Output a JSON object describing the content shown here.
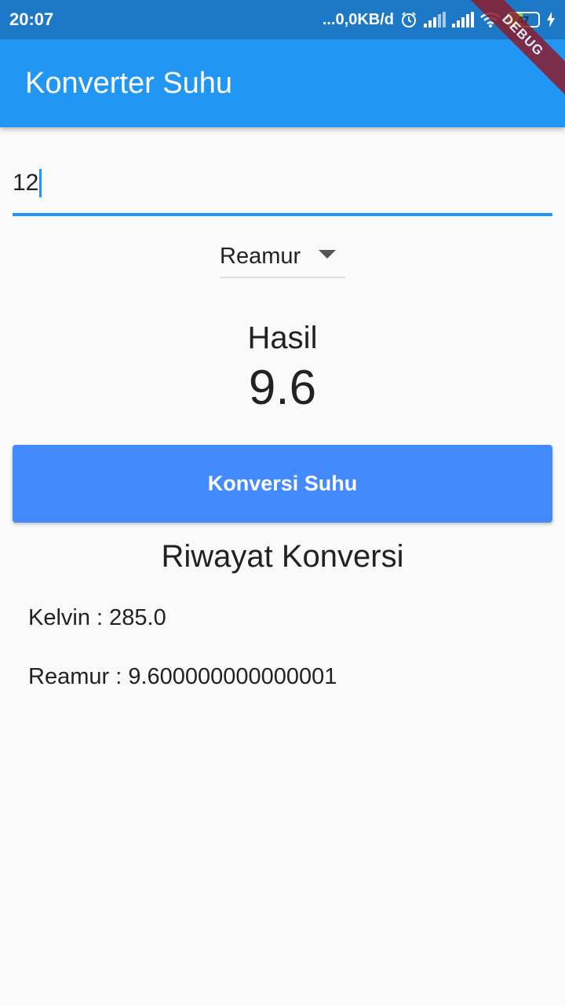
{
  "status_bar": {
    "time": "20:07",
    "network_speed": "...0,0KB/d",
    "battery_level": "47",
    "icons": [
      "alarm-icon",
      "signal-icon",
      "signal-icon",
      "wifi-icon",
      "battery-icon",
      "charging-icon"
    ]
  },
  "app_bar": {
    "title": "Konverter Suhu"
  },
  "debug_banner": "DEBUG",
  "input": {
    "value": "12"
  },
  "dropdown": {
    "selected": "Reamur"
  },
  "result": {
    "label": "Hasil",
    "value": "9.6"
  },
  "convert_button": {
    "label": "Konversi Suhu"
  },
  "history": {
    "title": "Riwayat Konversi",
    "items": [
      "Kelvin : 285.0",
      "Reamur : 9.600000000000001"
    ]
  },
  "colors": {
    "status_bar": "#1e78c8",
    "app_bar": "#2196f3",
    "button": "#448aff",
    "background": "#fafafa"
  }
}
